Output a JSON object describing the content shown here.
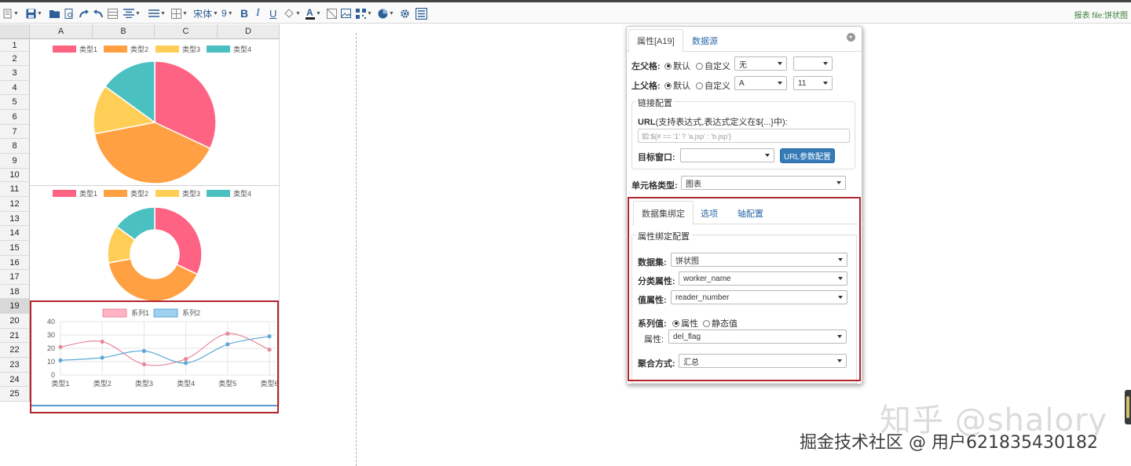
{
  "toolbar": {
    "font_name": "宋体",
    "font_size": "9",
    "right_text": "报表 file:饼状图"
  },
  "sheet": {
    "columns": [
      "A",
      "B",
      "C",
      "D"
    ],
    "rows": [
      "1",
      "2",
      "3",
      "4",
      "5",
      "6",
      "7",
      "8",
      "9",
      "10",
      "11",
      "12",
      "13",
      "14",
      "15",
      "16",
      "17",
      "18",
      "19",
      "20",
      "21",
      "22",
      "23",
      "24",
      "25"
    ],
    "selected_row": "19"
  },
  "charts": {
    "pie_legend": [
      "类型1",
      "类型2",
      "类型3",
      "类型4"
    ],
    "line_legend": [
      "系列1",
      "系列2"
    ]
  },
  "chart_data": [
    {
      "type": "pie",
      "labels": [
        "类型1",
        "类型2",
        "类型3",
        "类型4"
      ],
      "values": [
        32,
        40,
        13,
        15
      ],
      "colors": [
        "#ff6384",
        "#ffa042",
        "#ffce56",
        "#4bc0c0"
      ],
      "legend": "top"
    },
    {
      "type": "pie",
      "variant": "doughnut",
      "labels": [
        "类型1",
        "类型2",
        "类型3",
        "类型4"
      ],
      "values": [
        32,
        40,
        13,
        15
      ],
      "colors": [
        "#ff6384",
        "#ffa042",
        "#ffce56",
        "#4bc0c0"
      ],
      "legend": "top"
    },
    {
      "type": "line",
      "categories": [
        "类型1",
        "类型2",
        "类型3",
        "类型4",
        "类型5",
        "类型6"
      ],
      "series": [
        {
          "name": "系列1",
          "values": [
            21,
            25,
            8,
            12,
            31,
            19
          ],
          "color": "#e8889a"
        },
        {
          "name": "系列2",
          "values": [
            11,
            13,
            18,
            9,
            23,
            29
          ],
          "color": "#5aa9d6"
        }
      ],
      "ylim": [
        0,
        40
      ],
      "yticks": [
        0,
        10,
        20,
        30,
        40
      ],
      "grid": true,
      "legend": "top"
    }
  ],
  "panel": {
    "tabs": [
      "属性[A19]",
      "数据源"
    ],
    "left_parent_label": "左父格:",
    "top_parent_label": "上父格:",
    "default_label": "默认",
    "custom_label": "自定义",
    "left_parent_value": "无",
    "left_parent_value2": "",
    "top_parent_value": "A",
    "top_parent_value2": "11",
    "link_config_legend": "链接配置",
    "url_label_bold": "URL",
    "url_label_rest": "(支持表达式,表达式定义在${...}中):",
    "url_placeholder": "如:${# == '1' ? 'a.jsp' : 'b.jsp'}",
    "target_window_label": "目标窗口:",
    "target_window_value": "",
    "url_param_button": "URL参数配置",
    "cell_type_label": "单元格类型:",
    "cell_type_value": "图表",
    "subtabs": [
      "数据集绑定",
      "选项",
      "轴配置"
    ],
    "binding_legend": "属性绑定配置",
    "dataset_label": "数据集:",
    "dataset_value": "饼状图",
    "category_attr_label": "分类属性:",
    "category_attr_value": "worker_name",
    "value_attr_label": "值属性:",
    "value_attr_value": "reader_number",
    "series_value_label": "系列值:",
    "series_attr_option": "属性",
    "series_static_option": "静态值",
    "attr_label": "属性:",
    "attr_value": "del_flag",
    "aggregate_label": "聚合方式:",
    "aggregate_value": "汇总"
  },
  "watermark": {
    "line1": "知乎 @shalory",
    "line2": "掘金技术社区 @ 用户6218354301​82"
  }
}
